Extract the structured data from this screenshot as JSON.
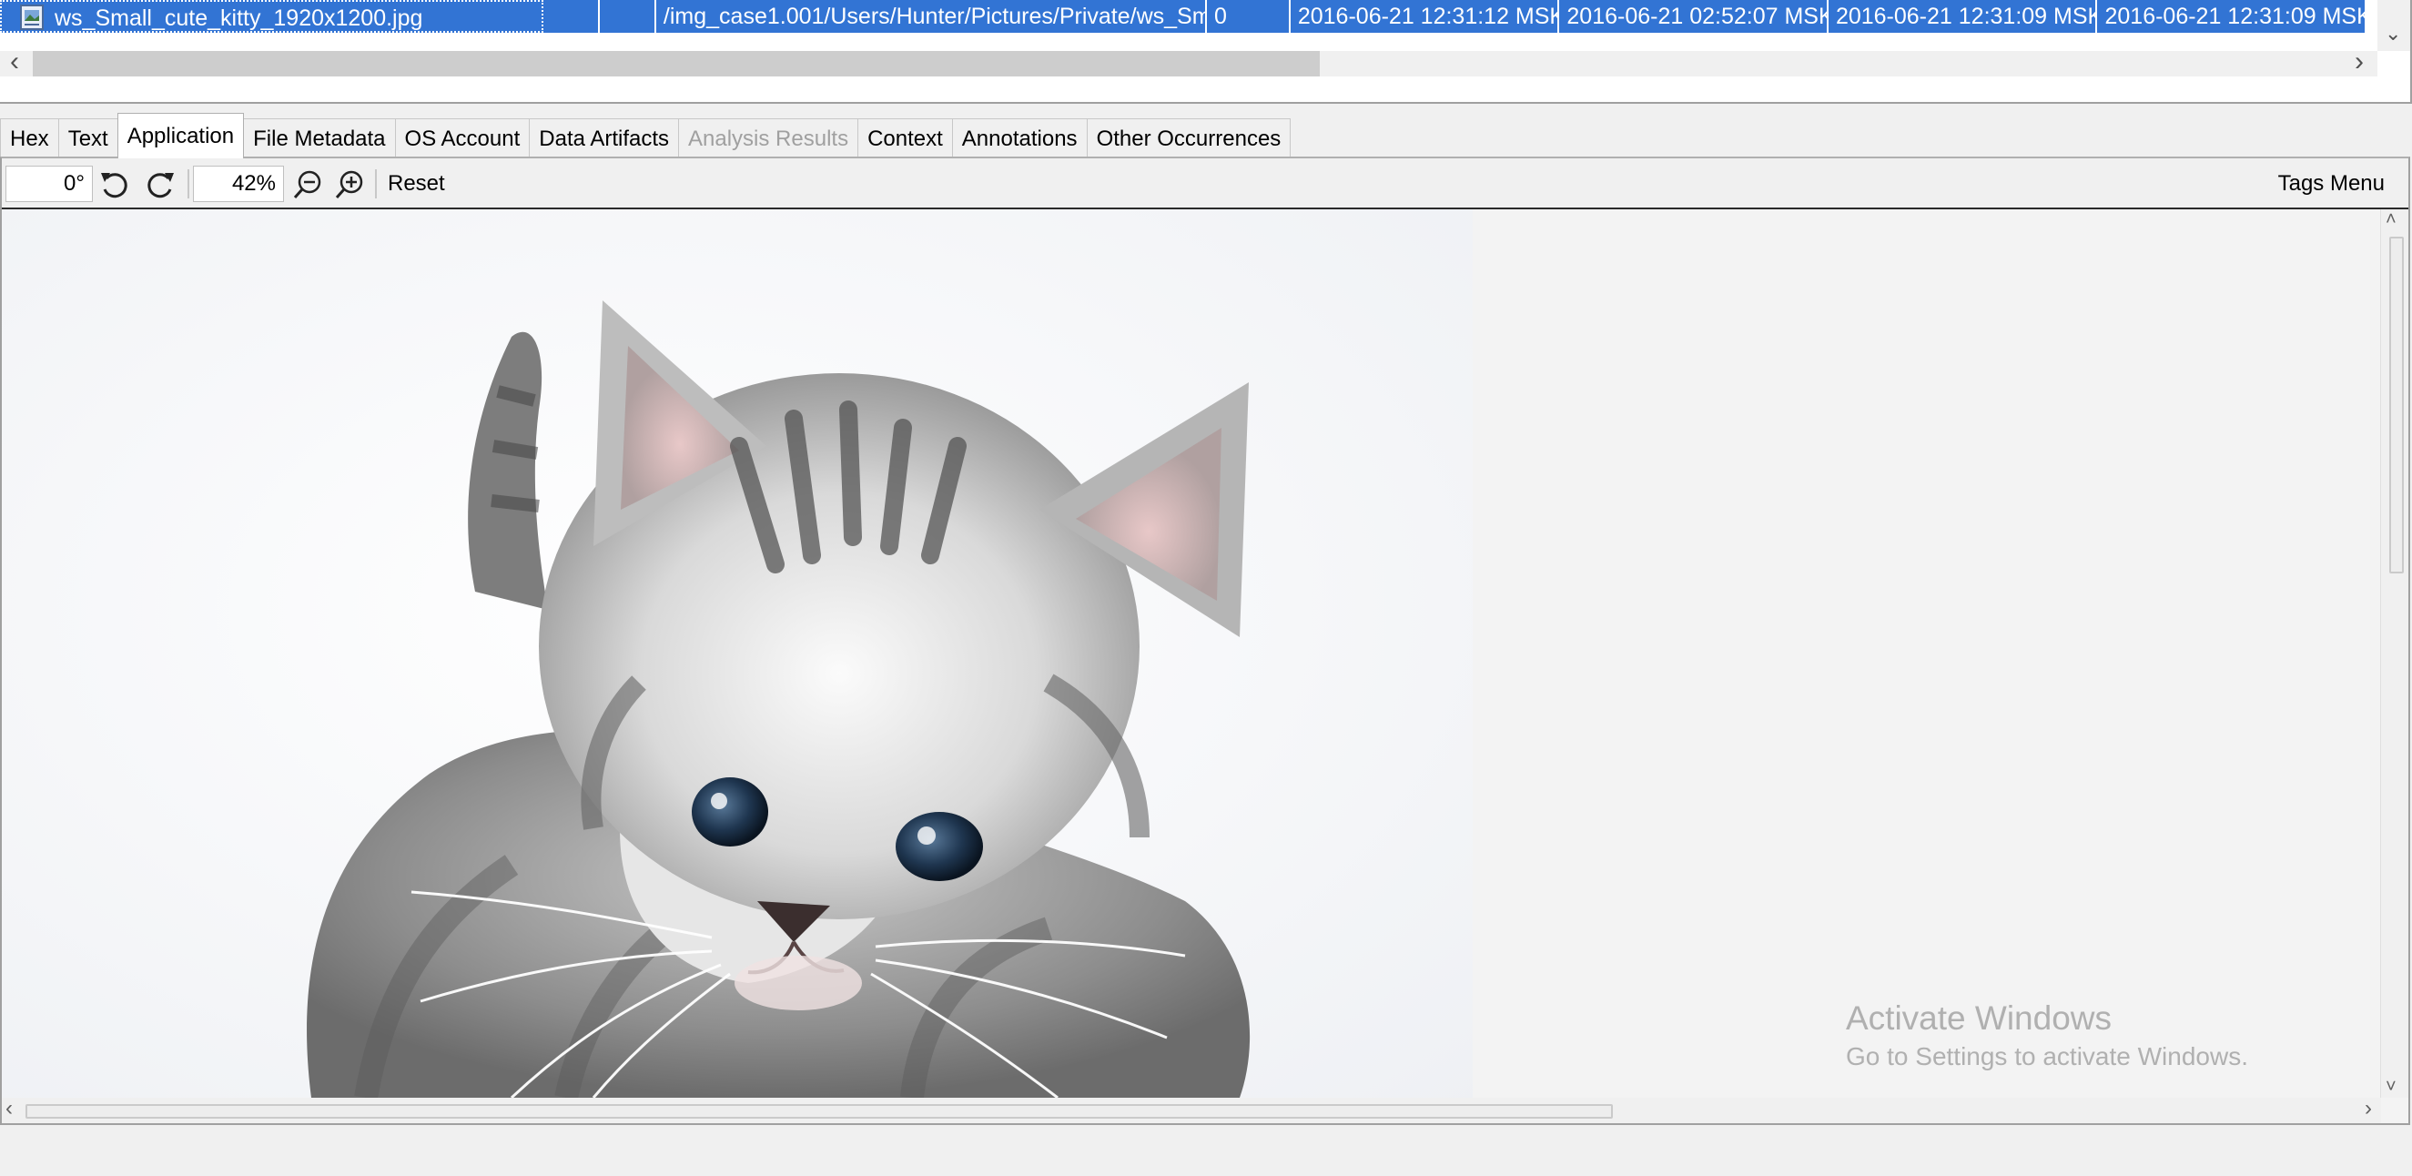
{
  "file_table": {
    "selected_row": {
      "name": "ws_Small_cute_kitty_1920x1200.jpg",
      "s1": "",
      "s2": "",
      "path": "/img_case1.001/Users/Hunter/Pictures/Private/ws_Sm...",
      "size": "0",
      "modified": "2016-06-21 12:31:12 MSK",
      "changed": "2016-06-21 02:52:07 MSK",
      "accessed": "2016-06-21 12:31:09 MSK",
      "created": "2016-06-21 12:31:09 MSK"
    }
  },
  "tabs": [
    {
      "label": "Hex"
    },
    {
      "label": "Text"
    },
    {
      "label": "Application"
    },
    {
      "label": "File Metadata"
    },
    {
      "label": "OS Account"
    },
    {
      "label": "Data Artifacts"
    },
    {
      "label": "Analysis Results"
    },
    {
      "label": "Context"
    },
    {
      "label": "Annotations"
    },
    {
      "label": "Other Occurrences"
    }
  ],
  "active_tab": "Application",
  "disabled_tab": "Analysis Results",
  "toolbar": {
    "rotation": "0°",
    "zoom": "42%",
    "reset_label": "Reset",
    "tags_menu_label": "Tags Menu",
    "icons": [
      "rotate-left-icon",
      "rotate-right-icon",
      "zoom-out-icon",
      "zoom-in-icon"
    ]
  },
  "watermark": {
    "title": "Activate Windows",
    "subtitle": "Go to Settings to activate Windows."
  },
  "colors": {
    "selection": "#3274d4",
    "background": "#f0f0f0"
  }
}
